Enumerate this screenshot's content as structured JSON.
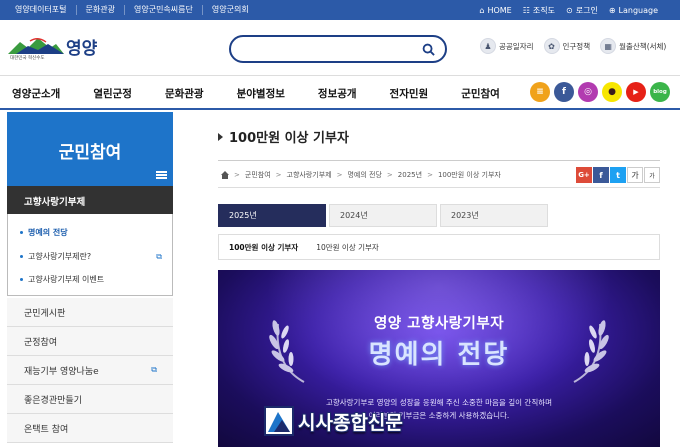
{
  "topbar": {
    "links": [
      "영양데이터포털",
      "문화관광",
      "영양군민속씨름단",
      "영양군의회"
    ],
    "util": [
      {
        "icon": "home-icon",
        "label": "HOME"
      },
      {
        "icon": "sitemap-icon",
        "label": "조직도"
      },
      {
        "icon": "lock-icon",
        "label": "로그인"
      },
      {
        "icon": "globe-icon",
        "label": "Language"
      }
    ]
  },
  "header": {
    "logo_text": "영양",
    "logo_sub": "대한민국 혁신수도",
    "search_placeholder": "",
    "quick": [
      {
        "icon": "job-icon",
        "label": "공공일자리"
      },
      {
        "icon": "policy-icon",
        "label": "인구정책"
      },
      {
        "icon": "calendar-icon",
        "label": "월출산책(서체)"
      }
    ]
  },
  "nav": {
    "items": [
      "영양군소개",
      "열린군정",
      "문화관광",
      "분야별정보",
      "정보공개",
      "전자민원",
      "군민참여"
    ],
    "social": [
      {
        "name": "menu-icon",
        "color": "#f0a21b",
        "glyph": "≡"
      },
      {
        "name": "facebook-icon",
        "color": "#3b5998",
        "glyph": "f"
      },
      {
        "name": "instagram-icon",
        "color": "#b23bb0",
        "glyph": "◎"
      },
      {
        "name": "kakao-icon",
        "color": "#f7e600",
        "glyph": "●"
      },
      {
        "name": "youtube-icon",
        "color": "#e62117",
        "glyph": "▶"
      },
      {
        "name": "blog-icon",
        "color": "#3bb54a",
        "glyph": "blog"
      }
    ]
  },
  "sidebar": {
    "title": "군민참여",
    "section": "고향사랑기부제",
    "sub_items": [
      {
        "label": "명예의 전당",
        "active": true,
        "ext": false
      },
      {
        "label": "고향사랑기부제란?",
        "active": false,
        "ext": true
      },
      {
        "label": "고향사랑기부제 이벤트",
        "active": false,
        "ext": false
      }
    ],
    "items": [
      {
        "label": "군민게시판",
        "ext": false
      },
      {
        "label": "군정참여",
        "ext": false
      },
      {
        "label": "재능기부 영양나눔e",
        "ext": true
      },
      {
        "label": "좋은경관만들기",
        "ext": false
      },
      {
        "label": "온택트 참여",
        "ext": false
      }
    ]
  },
  "content": {
    "title": "100만원 이상 기부자",
    "breadcrumb": [
      "군민참여",
      "고향사랑기부제",
      "명예의 전당",
      "2025년",
      "100만원 이상 기부자"
    ],
    "share": [
      {
        "name": "google-plus-icon",
        "color": "#dd4b39",
        "glyph": "G+"
      },
      {
        "name": "facebook-share-icon",
        "color": "#3b5998",
        "glyph": "f"
      },
      {
        "name": "twitter-share-icon",
        "color": "#1da1f2",
        "glyph": "t"
      }
    ],
    "font_up": "가",
    "font_down": "가",
    "year_tabs": [
      {
        "label": "2025년",
        "active": true
      },
      {
        "label": "2024년",
        "active": false
      },
      {
        "label": "2023년",
        "active": false
      }
    ],
    "sub_tabs": [
      {
        "label": "100만원 이상 기부자",
        "active": true
      },
      {
        "label": "10만원 이상 기부자",
        "active": false
      }
    ]
  },
  "banner": {
    "line1": "영양 고향사랑기부자",
    "line2": "명예의 전당",
    "desc1": "고향사랑기부로 영양의 성장을 응원해 주신 소중한 마음을 깊이 간직하며",
    "desc2": "여러분의 기부금은 소중하게 사용하겠습니다."
  },
  "watermark": {
    "text": "시사종합신문"
  }
}
